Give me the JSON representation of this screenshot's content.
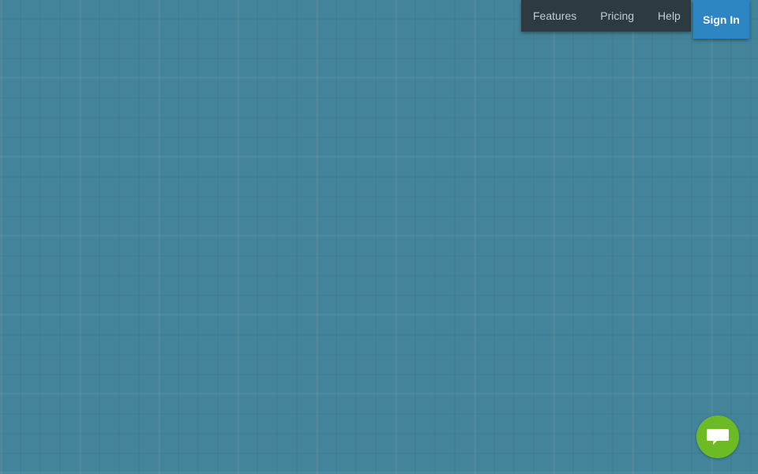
{
  "nav": {
    "items": [
      {
        "label": "Features"
      },
      {
        "label": "Pricing"
      },
      {
        "label": "Help"
      }
    ],
    "signin_label": "Sign In"
  },
  "chat": {
    "icon": "chat-bubble-icon"
  },
  "colors": {
    "background": "#43849b",
    "nav_background": "#2e3a41",
    "signin_background": "#2d85c4",
    "chat_background": "#6dbb24"
  }
}
